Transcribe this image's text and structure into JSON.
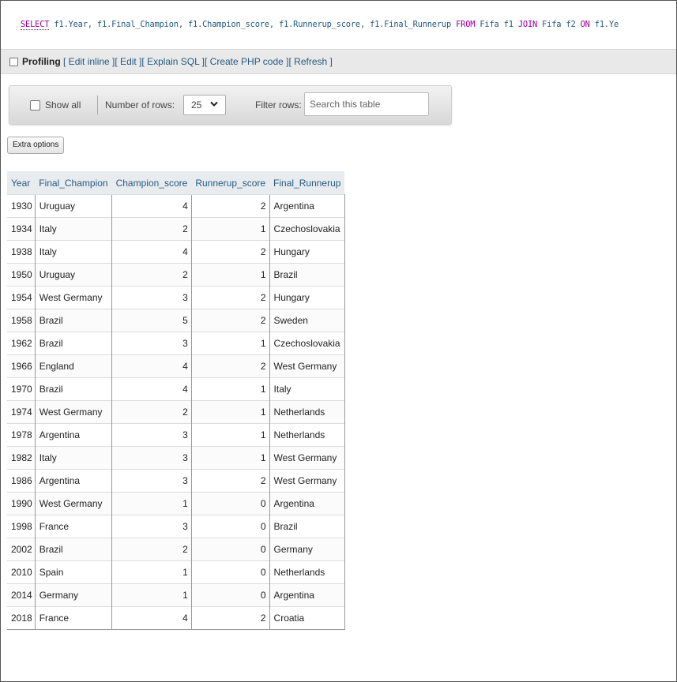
{
  "query": {
    "keyword_select": "SELECT",
    "part1": " f1.Year, f1.Final_Champion, f1.Champion_score, f1.Runnerup_score, f1.Final_Runnerup ",
    "keyword_from": "FROM",
    "part2": " Fifa f1 ",
    "keyword_join": "JOIN",
    "part3": " Fifa f2 ",
    "keyword_on": "ON",
    "part4": " f1.Ye"
  },
  "profiling": {
    "label": "Profiling",
    "links": [
      "[ Edit inline ]",
      "[ Edit ]",
      "[ Explain SQL ]",
      "[ Create PHP code ]",
      "[ Refresh ]"
    ]
  },
  "navigation": {
    "show_all_label": "Show all",
    "rows_label": "Number of rows:",
    "rows_value": "25",
    "filter_label": "Filter rows:",
    "search_placeholder": "Search this table"
  },
  "extra_options_label": "Extra options",
  "table": {
    "columns": [
      "Year",
      "Final_Champion",
      "Champion_score",
      "Runnerup_score",
      "Final_Runnerup"
    ],
    "rows": [
      [
        "1930",
        "Uruguay",
        "4",
        "2",
        "Argentina"
      ],
      [
        "1934",
        "Italy",
        "2",
        "1",
        "Czechoslovakia"
      ],
      [
        "1938",
        "Italy",
        "4",
        "2",
        "Hungary"
      ],
      [
        "1950",
        "Uruguay",
        "2",
        "1",
        "Brazil"
      ],
      [
        "1954",
        "West Germany",
        "3",
        "2",
        "Hungary"
      ],
      [
        "1958",
        "Brazil",
        "5",
        "2",
        "Sweden"
      ],
      [
        "1962",
        "Brazil",
        "3",
        "1",
        "Czechoslovakia"
      ],
      [
        "1966",
        "England",
        "4",
        "2",
        "West Germany"
      ],
      [
        "1970",
        "Brazil",
        "4",
        "1",
        "Italy"
      ],
      [
        "1974",
        "West Germany",
        "2",
        "1",
        "Netherlands"
      ],
      [
        "1978",
        "Argentina",
        "3",
        "1",
        "Netherlands"
      ],
      [
        "1982",
        "Italy",
        "3",
        "1",
        "West Germany"
      ],
      [
        "1986",
        "Argentina",
        "3",
        "2",
        "West Germany"
      ],
      [
        "1990",
        "West Germany",
        "1",
        "0",
        "Argentina"
      ],
      [
        "1998",
        "France",
        "3",
        "0",
        "Brazil"
      ],
      [
        "2002",
        "Brazil",
        "2",
        "0",
        "Germany"
      ],
      [
        "2010",
        "Spain",
        "1",
        "0",
        "Netherlands"
      ],
      [
        "2014",
        "Germany",
        "1",
        "0",
        "Argentina"
      ],
      [
        "2018",
        "France",
        "4",
        "2",
        "Croatia"
      ]
    ]
  },
  "colors": {
    "link": "#235a81",
    "sql_keyword": "#990099",
    "header_bg": "#e9ecef"
  }
}
